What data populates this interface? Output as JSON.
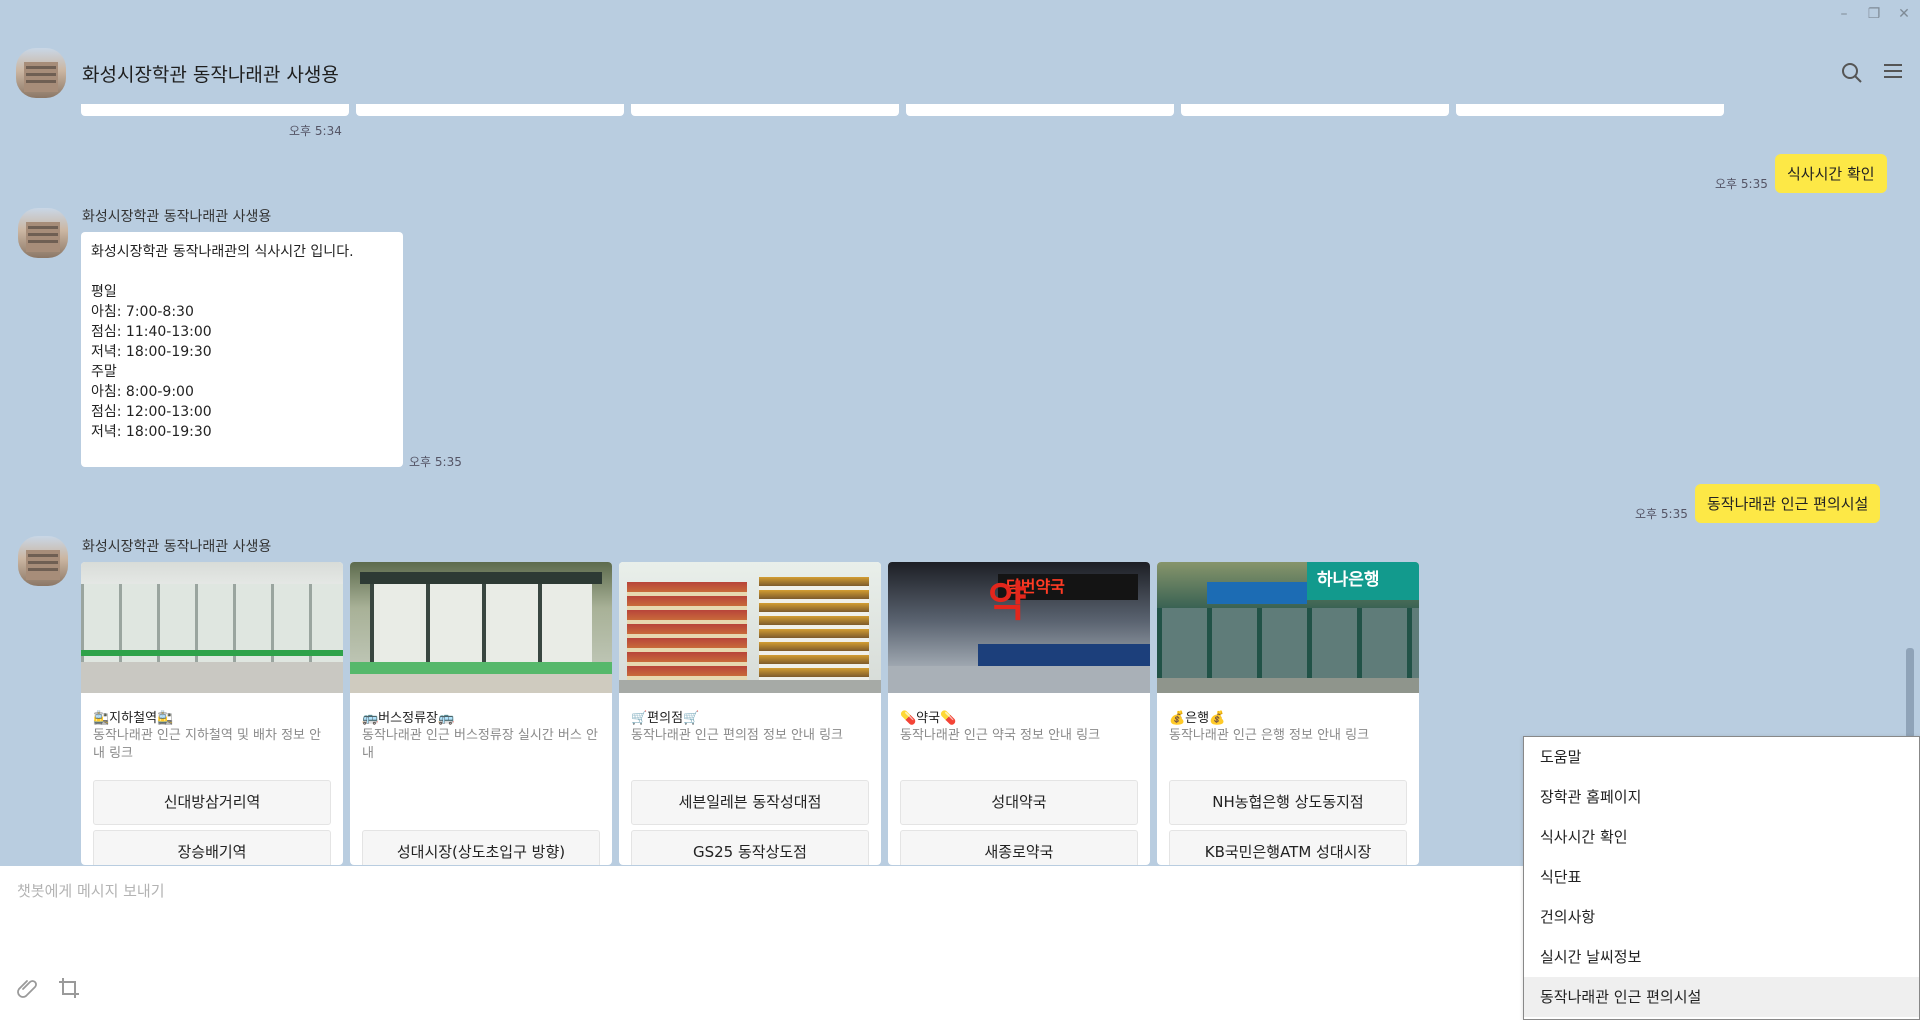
{
  "chat": {
    "title": "화성시장학관 동작나래관 사생용"
  },
  "messages": {
    "prev_time": "오후 5:34",
    "user1": {
      "text": "식사시간 확인",
      "time": "오후 5:35"
    },
    "bot1": {
      "sender": "화성시장학관 동작나래관 사생용",
      "text": "화성시장학관 동작나래관의 식사시간 입니다.\n\n평일\n아침: 7:00-8:30\n점심: 11:40-13:00\n저녁: 18:00-19:30\n주말\n아침: 8:00-9:00\n점심: 12:00-13:00\n저녁: 18:00-19:30",
      "time": "오후 5:35"
    },
    "user2": {
      "text": "동작나래관 인근 편의시설",
      "time": "오후 5:35"
    },
    "bot2": {
      "sender": "화성시장학관 동작나래관 사생용",
      "cards": [
        {
          "title": "🚉지하철역🚉",
          "desc": "동작나래관 인근 지하철역 및 배차 정보 안내 링크",
          "buttons": [
            "신대방삼거리역",
            "장승배기역"
          ]
        },
        {
          "title": "🚌버스정류장🚌",
          "desc": "동작나래관 인근 버스정류장 실시간 버스 안내",
          "buttons": [
            "성대시장(상도초입구 방향)"
          ]
        },
        {
          "title": "🛒편의점🛒",
          "desc": "동작나래관 인근 편의점 정보 안내 링크",
          "buttons": [
            "세븐일레븐 동작성대점",
            "GS25 동작상도점"
          ]
        },
        {
          "title": "💊약국💊",
          "desc": "동작나래관 인근 약국 정보 안내 링크",
          "buttons": [
            "성대약국",
            "새종로약국"
          ]
        },
        {
          "title": "💰은행💰",
          "desc": "동작나래관 인근 은행 정보 안내 링크",
          "buttons": [
            "NH농협은행 상도동지점",
            "KB국민은행ATM 성대시장"
          ]
        }
      ]
    }
  },
  "input": {
    "placeholder": "챗봇에게 메시지 보내기"
  },
  "quick_menu": {
    "items": [
      "도움말",
      "장학관 홈페이지",
      "식사시간 확인",
      "식단표",
      "건의사항",
      "실시간 날씨정보",
      "동작나래관 인근 편의시설"
    ],
    "active_index": 6
  },
  "card_image_labels": {
    "pharmacy_sign": "약",
    "pharmacy_banner": "당번약국",
    "bank_sign": "하나은행"
  },
  "colors": {
    "background": "#b9cde0",
    "my_bubble": "#fde846",
    "bot_bubble": "#ffffff"
  },
  "icons": {
    "search": "search-icon",
    "menu": "hamburger-menu-icon",
    "attach": "paperclip-icon",
    "crop": "crop-icon"
  }
}
